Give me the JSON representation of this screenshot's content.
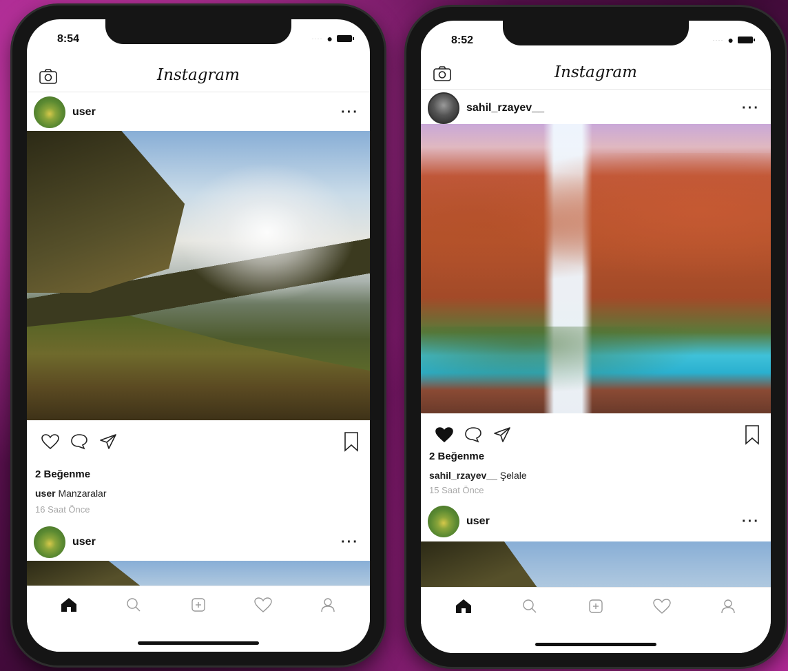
{
  "app": {
    "title": "Instagram"
  },
  "phones": [
    {
      "status_time": "8:54",
      "posts": [
        {
          "username": "user",
          "liked": false,
          "likes_text": "2 Beğenme",
          "caption_user": "user",
          "caption_text": "Manzaralar",
          "time_ago": "16 Saat Önce"
        },
        {
          "username": "user"
        }
      ]
    },
    {
      "status_time": "8:52",
      "posts": [
        {
          "username": "sahil_rzayev__",
          "liked": true,
          "likes_text": "2 Beğenme",
          "caption_user": "sahil_rzayev__",
          "caption_text": "Şelale",
          "time_ago": "15 Saat Önce"
        },
        {
          "username": "user"
        }
      ]
    }
  ],
  "tabbar": {
    "icons": [
      "home-icon",
      "search-icon",
      "add-post-icon",
      "activity-heart-icon",
      "profile-icon"
    ],
    "active": "home"
  },
  "colors": {
    "liked_heart": "#111111",
    "muted_text": "#a8a8a8"
  }
}
